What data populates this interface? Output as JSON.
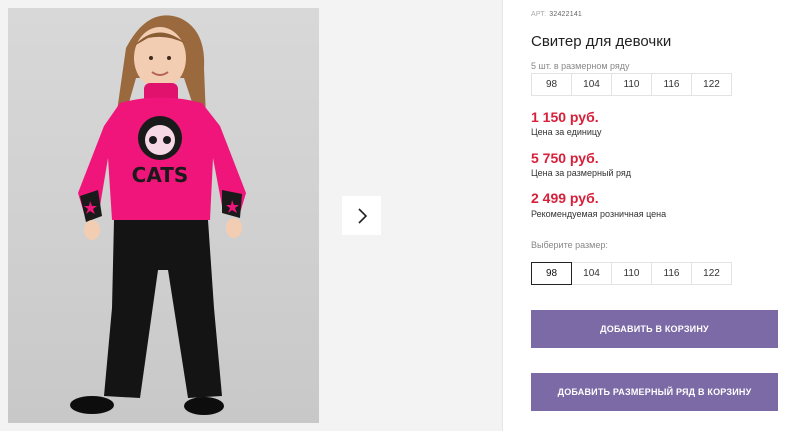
{
  "product": {
    "article_label": "АРТ.",
    "article_value": "32422141",
    "title": "Свитер для девочки"
  },
  "pack": {
    "note": "5 шт. в размерном ряду",
    "sizes": [
      "98",
      "104",
      "110",
      "116",
      "122"
    ]
  },
  "prices": [
    {
      "amount": "1 150 руб.",
      "caption": "Цена за единицу"
    },
    {
      "amount": "5 750 руб.",
      "caption": "Цена за размерный ряд"
    },
    {
      "amount": "2 499 руб.",
      "caption": "Рекомендуемая розничная цена"
    }
  ],
  "size_select": {
    "label": "Выберите размер:",
    "sizes": [
      "98",
      "104",
      "110",
      "116",
      "122"
    ],
    "selected": "98"
  },
  "buttons": {
    "add_to_cart": "ДОБАВИТЬ В КОРЗИНУ",
    "add_pack_to_cart": "ДОБАВИТЬ РАЗМЕРНЫЙ РЯД В КОРЗИНУ"
  },
  "gallery": {
    "sweater_print_text": "CATS",
    "next_icon": "chevron-right-icon"
  },
  "colors": {
    "price": "#d81f3a",
    "button": "#7b6aa6",
    "sweater": "#f0157a"
  }
}
